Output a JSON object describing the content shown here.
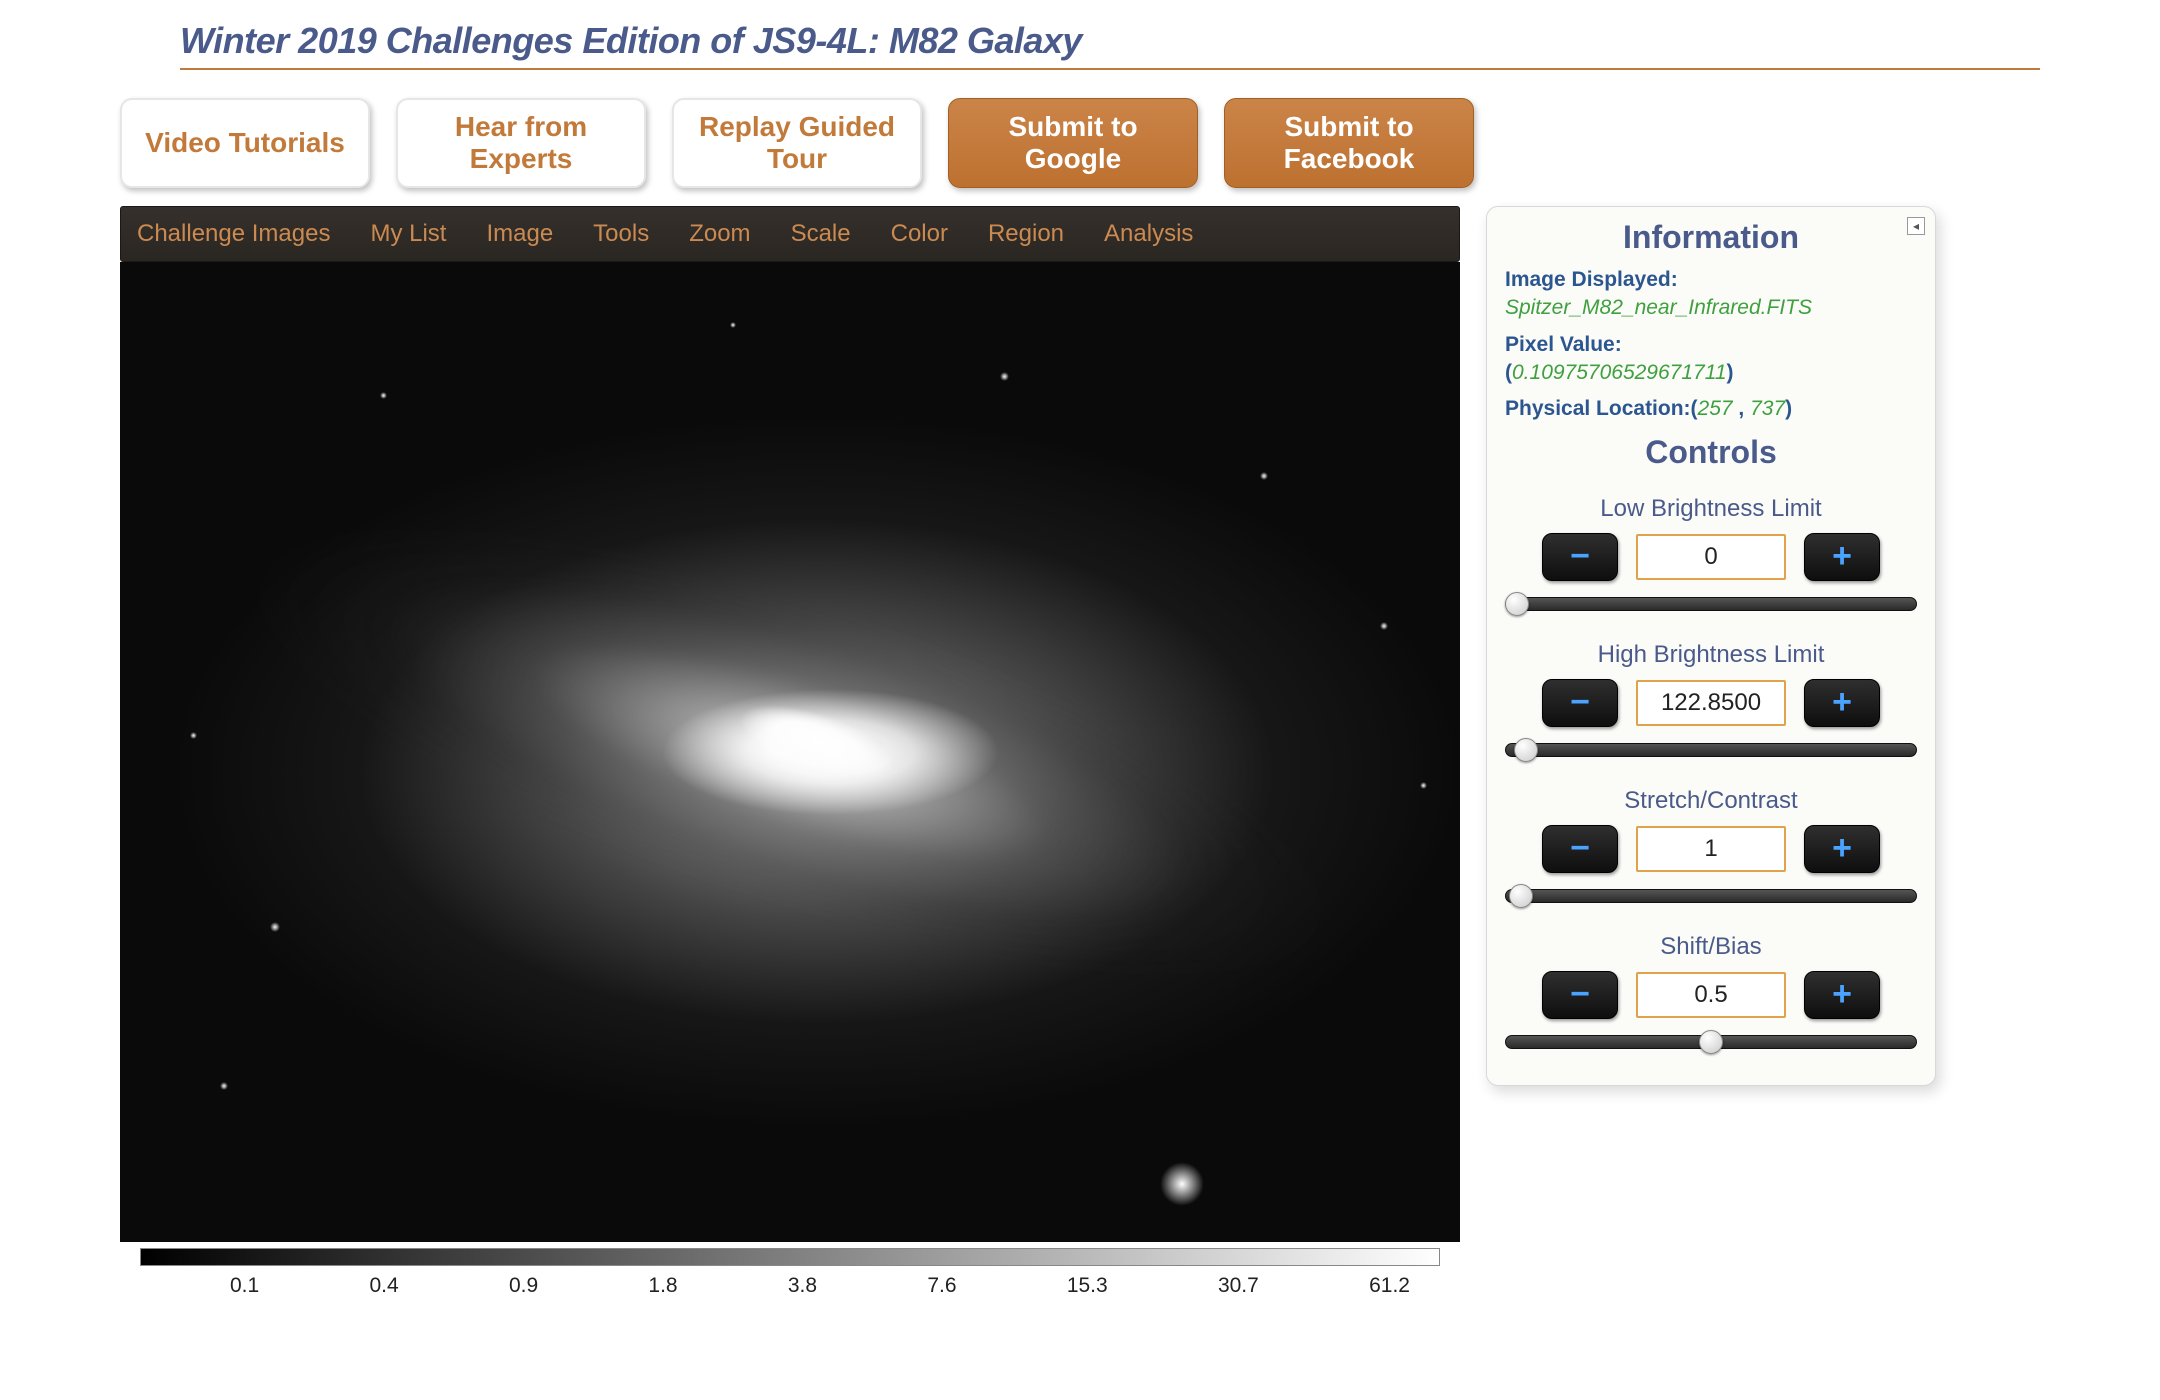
{
  "title": "Winter 2019 Challenges Edition of JS9-4L: M82 Galaxy",
  "buttons": {
    "tutorials": "Video Tutorials",
    "experts": "Hear from Experts",
    "replay": "Replay Guided Tour",
    "submit_google": "Submit to Google",
    "submit_facebook": "Submit to Facebook"
  },
  "menu": {
    "challenge_images": "Challenge Images",
    "my_list": "My List",
    "image": "Image",
    "tools": "Tools",
    "zoom": "Zoom",
    "scale": "Scale",
    "color": "Color",
    "region": "Region",
    "analysis": "Analysis"
  },
  "ticks": [
    "0.1",
    "0.4",
    "0.9",
    "1.8",
    "3.8",
    "7.6",
    "15.3",
    "30.7",
    "61.2"
  ],
  "info": {
    "heading": "Information",
    "image_displayed_label": "Image Displayed:",
    "image_displayed_value": "Spitzer_M82_near_Infrared.FITS",
    "pixel_value_label": "Pixel Value:",
    "pixel_value_value": "0.10975706529671711",
    "phys_loc_label": "Physical Location:",
    "phys_loc_x": "257",
    "phys_loc_y": "737"
  },
  "controls": {
    "heading": "Controls",
    "low": {
      "label": "Low Brightness Limit",
      "value": "0",
      "slider_pct": 3
    },
    "high": {
      "label": "High Brightness Limit",
      "value": "122.8500",
      "slider_pct": 5
    },
    "stretch": {
      "label": "Stretch/Contrast",
      "value": "1",
      "slider_pct": 4
    },
    "bias": {
      "label": "Shift/Bias",
      "value": "0.5",
      "slider_pct": 50
    }
  },
  "glyph": {
    "minus": "−",
    "plus": "+",
    "collapse": "◂"
  }
}
